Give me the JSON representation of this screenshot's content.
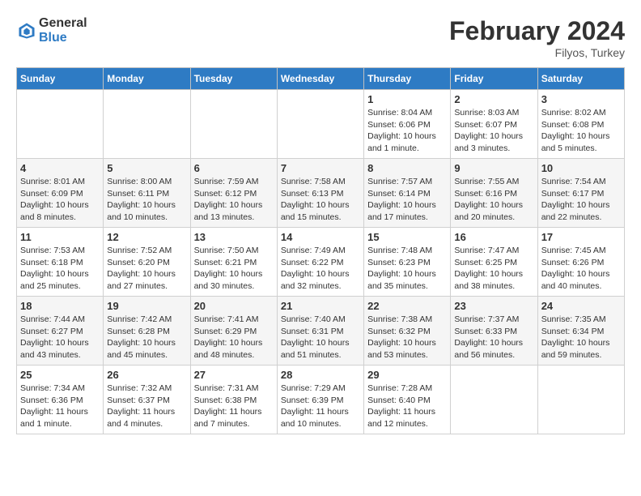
{
  "header": {
    "logo_general": "General",
    "logo_blue": "Blue",
    "month_title": "February 2024",
    "location": "Filyos, Turkey"
  },
  "weekdays": [
    "Sunday",
    "Monday",
    "Tuesday",
    "Wednesday",
    "Thursday",
    "Friday",
    "Saturday"
  ],
  "weeks": [
    [
      {
        "day": "",
        "info": ""
      },
      {
        "day": "",
        "info": ""
      },
      {
        "day": "",
        "info": ""
      },
      {
        "day": "",
        "info": ""
      },
      {
        "day": "1",
        "info": "Sunrise: 8:04 AM\nSunset: 6:06 PM\nDaylight: 10 hours and 1 minute."
      },
      {
        "day": "2",
        "info": "Sunrise: 8:03 AM\nSunset: 6:07 PM\nDaylight: 10 hours and 3 minutes."
      },
      {
        "day": "3",
        "info": "Sunrise: 8:02 AM\nSunset: 6:08 PM\nDaylight: 10 hours and 5 minutes."
      }
    ],
    [
      {
        "day": "4",
        "info": "Sunrise: 8:01 AM\nSunset: 6:09 PM\nDaylight: 10 hours and 8 minutes."
      },
      {
        "day": "5",
        "info": "Sunrise: 8:00 AM\nSunset: 6:11 PM\nDaylight: 10 hours and 10 minutes."
      },
      {
        "day": "6",
        "info": "Sunrise: 7:59 AM\nSunset: 6:12 PM\nDaylight: 10 hours and 13 minutes."
      },
      {
        "day": "7",
        "info": "Sunrise: 7:58 AM\nSunset: 6:13 PM\nDaylight: 10 hours and 15 minutes."
      },
      {
        "day": "8",
        "info": "Sunrise: 7:57 AM\nSunset: 6:14 PM\nDaylight: 10 hours and 17 minutes."
      },
      {
        "day": "9",
        "info": "Sunrise: 7:55 AM\nSunset: 6:16 PM\nDaylight: 10 hours and 20 minutes."
      },
      {
        "day": "10",
        "info": "Sunrise: 7:54 AM\nSunset: 6:17 PM\nDaylight: 10 hours and 22 minutes."
      }
    ],
    [
      {
        "day": "11",
        "info": "Sunrise: 7:53 AM\nSunset: 6:18 PM\nDaylight: 10 hours and 25 minutes."
      },
      {
        "day": "12",
        "info": "Sunrise: 7:52 AM\nSunset: 6:20 PM\nDaylight: 10 hours and 27 minutes."
      },
      {
        "day": "13",
        "info": "Sunrise: 7:50 AM\nSunset: 6:21 PM\nDaylight: 10 hours and 30 minutes."
      },
      {
        "day": "14",
        "info": "Sunrise: 7:49 AM\nSunset: 6:22 PM\nDaylight: 10 hours and 32 minutes."
      },
      {
        "day": "15",
        "info": "Sunrise: 7:48 AM\nSunset: 6:23 PM\nDaylight: 10 hours and 35 minutes."
      },
      {
        "day": "16",
        "info": "Sunrise: 7:47 AM\nSunset: 6:25 PM\nDaylight: 10 hours and 38 minutes."
      },
      {
        "day": "17",
        "info": "Sunrise: 7:45 AM\nSunset: 6:26 PM\nDaylight: 10 hours and 40 minutes."
      }
    ],
    [
      {
        "day": "18",
        "info": "Sunrise: 7:44 AM\nSunset: 6:27 PM\nDaylight: 10 hours and 43 minutes."
      },
      {
        "day": "19",
        "info": "Sunrise: 7:42 AM\nSunset: 6:28 PM\nDaylight: 10 hours and 45 minutes."
      },
      {
        "day": "20",
        "info": "Sunrise: 7:41 AM\nSunset: 6:29 PM\nDaylight: 10 hours and 48 minutes."
      },
      {
        "day": "21",
        "info": "Sunrise: 7:40 AM\nSunset: 6:31 PM\nDaylight: 10 hours and 51 minutes."
      },
      {
        "day": "22",
        "info": "Sunrise: 7:38 AM\nSunset: 6:32 PM\nDaylight: 10 hours and 53 minutes."
      },
      {
        "day": "23",
        "info": "Sunrise: 7:37 AM\nSunset: 6:33 PM\nDaylight: 10 hours and 56 minutes."
      },
      {
        "day": "24",
        "info": "Sunrise: 7:35 AM\nSunset: 6:34 PM\nDaylight: 10 hours and 59 minutes."
      }
    ],
    [
      {
        "day": "25",
        "info": "Sunrise: 7:34 AM\nSunset: 6:36 PM\nDaylight: 11 hours and 1 minute."
      },
      {
        "day": "26",
        "info": "Sunrise: 7:32 AM\nSunset: 6:37 PM\nDaylight: 11 hours and 4 minutes."
      },
      {
        "day": "27",
        "info": "Sunrise: 7:31 AM\nSunset: 6:38 PM\nDaylight: 11 hours and 7 minutes."
      },
      {
        "day": "28",
        "info": "Sunrise: 7:29 AM\nSunset: 6:39 PM\nDaylight: 11 hours and 10 minutes."
      },
      {
        "day": "29",
        "info": "Sunrise: 7:28 AM\nSunset: 6:40 PM\nDaylight: 11 hours and 12 minutes."
      },
      {
        "day": "",
        "info": ""
      },
      {
        "day": "",
        "info": ""
      }
    ]
  ]
}
